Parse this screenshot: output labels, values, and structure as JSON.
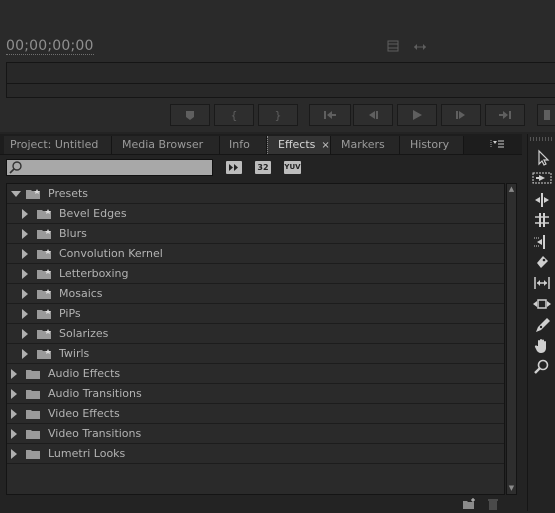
{
  "monitor": {
    "timecode": "00;00;00;00"
  },
  "panel": {
    "tabs": [
      {
        "label": "Project: Untitled"
      },
      {
        "label": "Media Browser"
      },
      {
        "label": "Info"
      },
      {
        "label": "Effects",
        "close": "×"
      },
      {
        "label": "Markers"
      },
      {
        "label": "History"
      }
    ],
    "search": {
      "value": "",
      "placeholder": ""
    },
    "filter_badges": [
      "32",
      "YUV"
    ],
    "tree": [
      {
        "label": "Presets",
        "expanded": true,
        "level": 0,
        "preset": true
      },
      {
        "label": "Bevel Edges",
        "expanded": false,
        "level": 1,
        "preset": true
      },
      {
        "label": "Blurs",
        "expanded": false,
        "level": 1,
        "preset": true
      },
      {
        "label": "Convolution Kernel",
        "expanded": false,
        "level": 1,
        "preset": true
      },
      {
        "label": "Letterboxing",
        "expanded": false,
        "level": 1,
        "preset": true
      },
      {
        "label": "Mosaics",
        "expanded": false,
        "level": 1,
        "preset": true
      },
      {
        "label": "PiPs",
        "expanded": false,
        "level": 1,
        "preset": true
      },
      {
        "label": "Solarizes",
        "expanded": false,
        "level": 1,
        "preset": true
      },
      {
        "label": "Twirls",
        "expanded": false,
        "level": 1,
        "preset": true
      },
      {
        "label": "Audio Effects",
        "expanded": false,
        "level": 0,
        "preset": false
      },
      {
        "label": "Audio Transitions",
        "expanded": false,
        "level": 0,
        "preset": false
      },
      {
        "label": "Video Effects",
        "expanded": false,
        "level": 0,
        "preset": false
      },
      {
        "label": "Video Transitions",
        "expanded": false,
        "level": 0,
        "preset": false
      },
      {
        "label": "Lumetri Looks",
        "expanded": false,
        "level": 0,
        "preset": false
      }
    ]
  },
  "tools": [
    {
      "name": "selection-tool-icon"
    },
    {
      "name": "track-select-tool-icon"
    },
    {
      "name": "ripple-edit-tool-icon"
    },
    {
      "name": "rolling-edit-tool-icon"
    },
    {
      "name": "rate-stretch-tool-icon"
    },
    {
      "name": "razor-tool-icon"
    },
    {
      "name": "slip-tool-icon"
    },
    {
      "name": "slide-tool-icon"
    },
    {
      "name": "pen-tool-icon"
    },
    {
      "name": "hand-tool-icon"
    },
    {
      "name": "zoom-tool-icon"
    }
  ],
  "colors": {
    "background": "#232323",
    "active_tab": "#343434",
    "text": "#b3b3b3"
  }
}
